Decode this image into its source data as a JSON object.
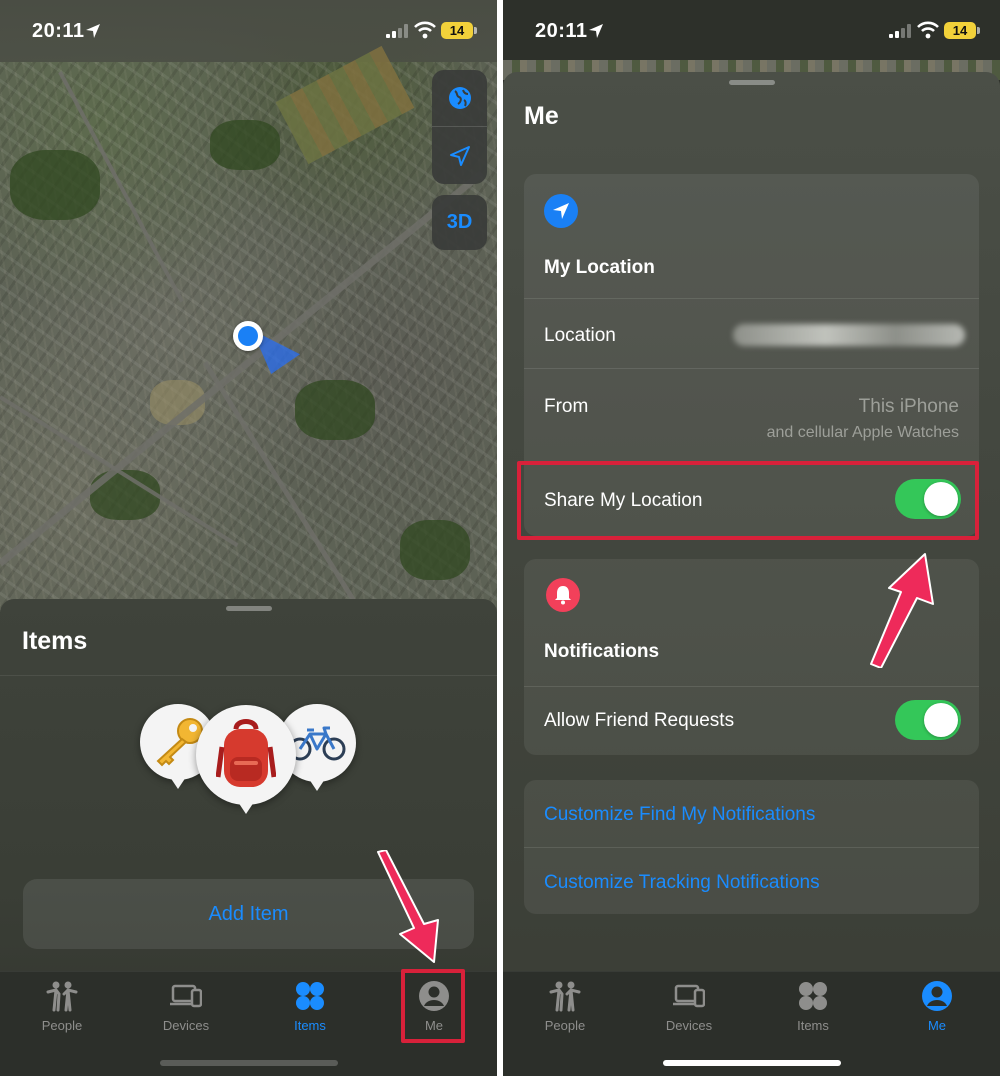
{
  "status": {
    "time": "20:11",
    "battery": "14"
  },
  "left": {
    "sheet_title": "Items",
    "add_item_label": "Add Item",
    "map_controls": {
      "three_d_label": "3D"
    },
    "items": [
      {
        "icon": "key-icon"
      },
      {
        "icon": "backpack-icon"
      },
      {
        "icon": "bicycle-icon"
      }
    ]
  },
  "right": {
    "sheet_title": "Me",
    "my_location": {
      "title": "My Location",
      "location_label": "Location",
      "from_label": "From",
      "from_value": "This iPhone",
      "from_sub": "and cellular Apple Watches",
      "share_label": "Share My Location",
      "share_on": true
    },
    "notifications": {
      "title": "Notifications",
      "allow_label": "Allow Friend Requests",
      "allow_on": true
    },
    "links": {
      "customize_findmy": "Customize Find My Notifications",
      "customize_tracking": "Customize Tracking Notifications"
    }
  },
  "tabbar": {
    "people": "People",
    "devices": "Devices",
    "items": "Items",
    "me": "Me"
  },
  "colors": {
    "accent": "#1a8cff",
    "toggle_on": "#34c759",
    "highlight": "#d8213a",
    "notification_icon": "#f2405a"
  }
}
